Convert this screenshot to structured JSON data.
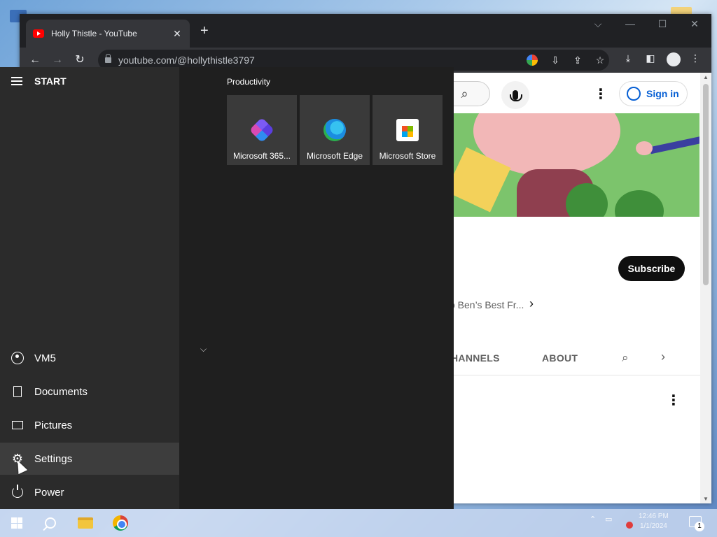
{
  "browser": {
    "tab_title": "Holly Thistle - YouTube",
    "url": "youtube.com/@hollythistle3797",
    "icons": [
      "back-icon",
      "forward-icon",
      "reload-icon",
      "google-icon",
      "install-icon",
      "share-icon",
      "star-icon",
      "download-icon",
      "side-panel-icon",
      "profile-icon",
      "menu-icon"
    ]
  },
  "youtube": {
    "sign_in": "Sign in",
    "subscribe": "Subscribe",
    "featured_link": "o Ben’s Best Fr...",
    "tabs": [
      "HANNELS",
      "ABOUT"
    ]
  },
  "start_menu": {
    "title": "START",
    "group_title": "Productivity",
    "tiles": [
      {
        "label": "Microsoft 365..."
      },
      {
        "label": "Microsoft Edge"
      },
      {
        "label": "Microsoft Store"
      }
    ],
    "rail_items": [
      {
        "label": "VM5"
      },
      {
        "label": "Documents"
      },
      {
        "label": "Pictures"
      },
      {
        "label": "Settings"
      },
      {
        "label": "Power"
      }
    ]
  },
  "taskbar": {
    "clock_time": "12:46 PM",
    "clock_date": "1/1/2024",
    "notification_count": "1"
  }
}
